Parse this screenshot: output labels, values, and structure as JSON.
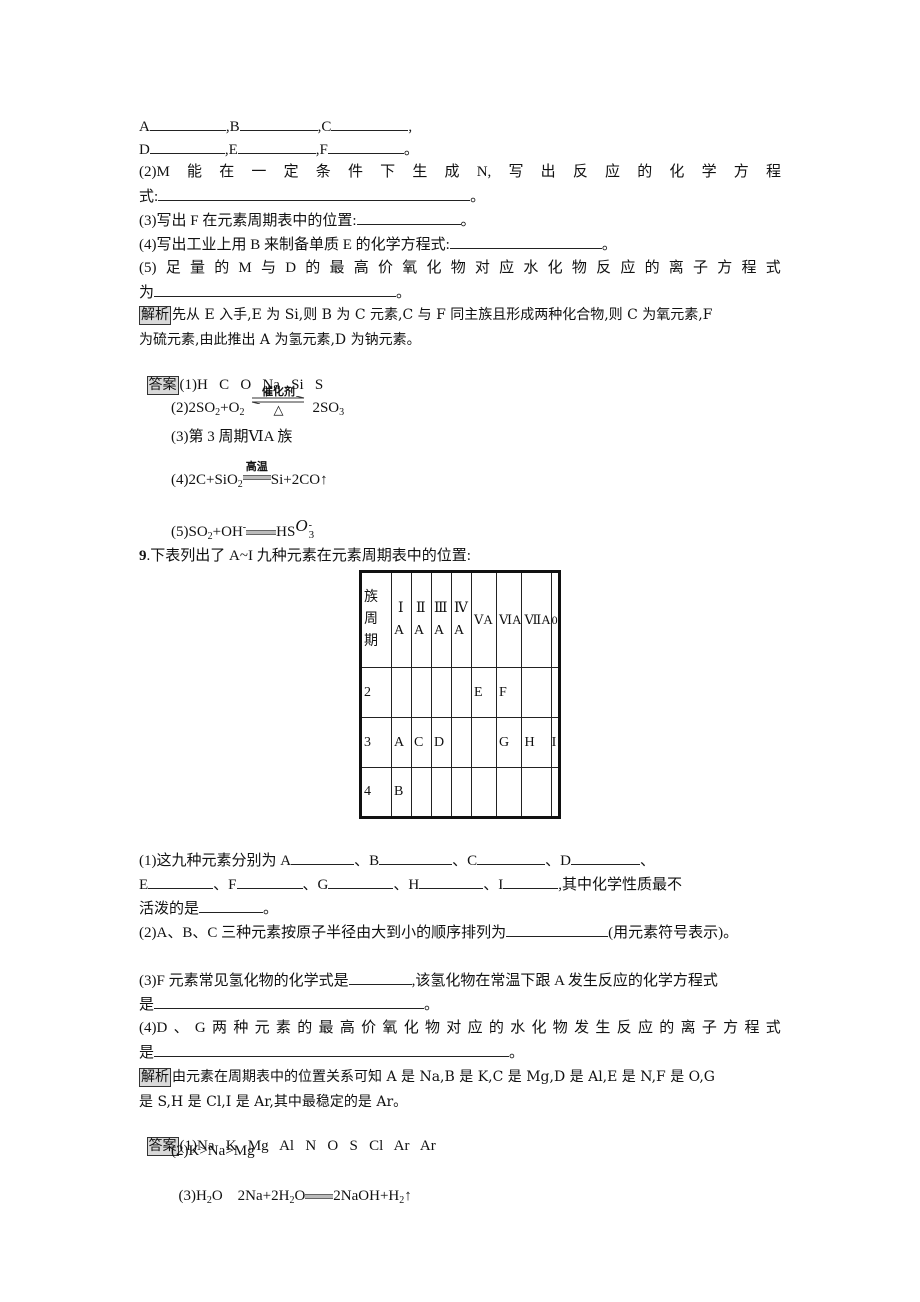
{
  "q8": {
    "blanks_row1": [
      "A",
      ",B",
      ",C",
      ","
    ],
    "blanks_row2": [
      "D",
      ",E",
      ",F",
      "。"
    ],
    "q2_words": [
      "(2)M",
      "能",
      "在",
      "一",
      "定",
      "条",
      "件",
      "下",
      "生",
      "成",
      "N,",
      "写",
      "出",
      "反",
      "应",
      "的",
      "化",
      "学",
      "方",
      "程"
    ],
    "q2_line2_prefix": "式:",
    "q2_line2_suffix": "。",
    "q3_prefix": "(3)写出 F 在元素周期表中的位置:",
    "q3_suffix": "。",
    "q4_prefix": "(4)写出工业上用 B 来制备单质 E 的化学方程式:",
    "q4_suffix": "。",
    "q5_words": [
      "(5)",
      "足",
      "量",
      "的",
      "M",
      "与",
      "D",
      "的",
      "最",
      "高",
      "价",
      "氧",
      "化",
      "物",
      "对",
      "应",
      "水",
      "化",
      "物",
      "反",
      "应",
      "的",
      "离",
      "子",
      "方",
      "程",
      "式"
    ],
    "q5_line2_prefix": "为",
    "q5_line2_suffix": "。",
    "analysis_tag": "解析",
    "analysis_line1": "先从 E 入手,E 为 Si,则 B 为 C 元素,C 与 F 同主族且形成两种化合物,则 C 为氧元素,F",
    "analysis_line2": "为硫元素,由此推出 A 为氢元素,D 为钠元素。",
    "answer_tag": "答案",
    "answer1": "(1)H   C   O   Na   Si   S",
    "answer2": {
      "left": "(2)2SO",
      "left_sub": "2",
      "mid": "+O",
      "mid_sub": "2",
      "cond_top": "催化剂",
      "cond_bottom": "△",
      "right": "2SO",
      "right_sub": "3"
    },
    "answer3": "(3)第 3 周期ⅥA 族",
    "answer4": {
      "left": "(4)2C+SiO",
      "left_sub": "2",
      "cond_top": "高温",
      "right": "Si+2CO↑"
    },
    "answer5": {
      "left": "(5)SO",
      "left_sub": "2",
      "mid": "+OH",
      "mid_sup": "-",
      "right": "HS",
      "tail": "O",
      "tail_sup": "-",
      "tail_sub": "3"
    }
  },
  "q9": {
    "number": "9",
    "stem": ".下表列出了 A~I 九种元素在元素周期表中的位置:",
    "table": {
      "corner": [
        "族",
        "周",
        "期"
      ],
      "headers": [
        [
          "Ⅰ",
          "A"
        ],
        [
          "Ⅱ",
          "A"
        ],
        [
          "Ⅲ",
          "A"
        ],
        [
          "Ⅳ",
          "A"
        ],
        [
          "ⅤA"
        ],
        [
          "ⅥA"
        ],
        [
          "ⅦA"
        ],
        [
          "0"
        ]
      ],
      "rows": [
        {
          "period": "2",
          "cells": [
            "",
            "",
            "",
            "",
            "E",
            "F",
            "",
            ""
          ]
        },
        {
          "period": "3",
          "cells": [
            "A",
            "C",
            "D",
            "",
            "",
            "G",
            "H",
            "I"
          ]
        },
        {
          "period": "4",
          "cells": [
            "B",
            "",
            "",
            "",
            "",
            "",
            "",
            ""
          ]
        }
      ]
    },
    "q1_line1": [
      "(1)这九种元素分别为 A",
      "、B",
      "、C",
      "、D",
      "、"
    ],
    "q1_line2": [
      "E",
      "、F",
      "、G",
      "、H",
      "、I",
      ",其中化学性质最不"
    ],
    "q1_line3_prefix": "活泼的是",
    "q1_line3_suffix": "。",
    "q2_prefix": "(2)A、B、C 三种元素按原子半径由大到小的顺序排列为",
    "q2_suffix": "(用元素符号表示)。",
    "q3_prefix": "(3)F 元素常见氢化物的化学式是",
    "q3_mid": ",该氢化物在常温下跟 A 发生反应的化学方程式",
    "q3_line2_prefix": "是",
    "q3_line2_suffix": "。",
    "q4_words": [
      "(4)D",
      "、",
      "G",
      "两",
      "种",
      "元",
      "素",
      "的",
      "最",
      "高",
      "价",
      "氧",
      "化",
      "物",
      "对",
      "应",
      "的",
      "水",
      "化",
      "物",
      "发",
      "生",
      "反",
      "应",
      "的",
      "离",
      "子",
      "方",
      "程",
      "式"
    ],
    "q4_line2_prefix": "是",
    "q4_line2_suffix": "。",
    "analysis_tag": "解析",
    "analysis_line1": "由元素在周期表中的位置关系可知 A 是 Na,B 是 K,C 是 Mg,D 是 Al,E 是 N,F 是 O,G",
    "analysis_line2": "是 S,H 是 Cl,I 是 Ar,其中最稳定的是 Ar。",
    "answer_tag": "答案",
    "answer1": "(1)Na   K   Mg   Al   N   O   S   Cl   Ar   Ar",
    "answer2": "(2)K>Na>Mg",
    "answer3": {
      "a": "(3)H",
      "a_sub": "2",
      "b": "O    2Na+2H",
      "b_sub": "2",
      "c": "O",
      "d": "2NaOH+H",
      "d_sub": "2",
      "e": "↑"
    }
  }
}
